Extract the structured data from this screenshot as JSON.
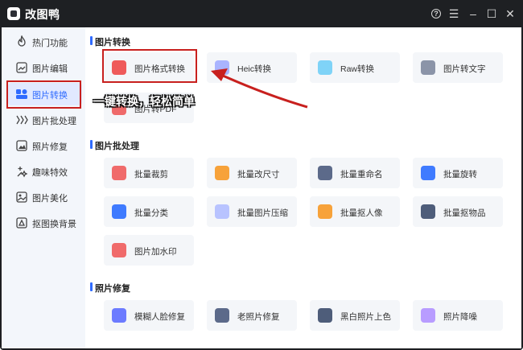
{
  "app": {
    "title": "改图鸭"
  },
  "window_controls": {
    "help": "?",
    "menu": "☰",
    "minimize": "–",
    "maximize": "☐",
    "close": "✕"
  },
  "sidebar": {
    "items": [
      {
        "label": "热门功能",
        "icon": "fire-icon"
      },
      {
        "label": "图片编辑",
        "icon": "image-edit-icon"
      },
      {
        "label": "图片转换",
        "icon": "convert-icon",
        "active": true
      },
      {
        "label": "图片批处理",
        "icon": "batch-icon"
      },
      {
        "label": "照片修复",
        "icon": "photo-repair-icon"
      },
      {
        "label": "趣味特效",
        "icon": "sparkle-icon"
      },
      {
        "label": "图片美化",
        "icon": "beautify-icon"
      },
      {
        "label": "抠图换背景",
        "icon": "cutout-icon"
      }
    ]
  },
  "sections": {
    "convert": {
      "title": "图片转换",
      "cards": [
        {
          "label": "图片格式转换",
          "color": "#ef5a5a"
        },
        {
          "label": "Heic转换",
          "color": "#a9b4ff"
        },
        {
          "label": "Raw转换",
          "color": "#7fd3f7"
        },
        {
          "label": "图片转文字",
          "color": "#8b94a8"
        },
        {
          "label": "图片转PDF",
          "color": "#ef6a6a"
        }
      ]
    },
    "batch": {
      "title": "图片批处理",
      "cards": [
        {
          "label": "批量裁剪",
          "color": "#f06b6b"
        },
        {
          "label": "批量改尺寸",
          "color": "#f7a23a"
        },
        {
          "label": "批量重命名",
          "color": "#5c6a8a"
        },
        {
          "label": "批量旋转",
          "color": "#3f7bff"
        },
        {
          "label": "批量分类",
          "color": "#3f7bff"
        },
        {
          "label": "批量图片压缩",
          "color": "#b8c3ff"
        },
        {
          "label": "批量抠人像",
          "color": "#f7a23a"
        },
        {
          "label": "批量抠物品",
          "color": "#4e5d7a"
        },
        {
          "label": "图片加水印",
          "color": "#f06b6b"
        }
      ]
    },
    "repair": {
      "title": "照片修复",
      "cards": [
        {
          "label": "模糊人脸修复",
          "color": "#6c7bff"
        },
        {
          "label": "老照片修复",
          "color": "#5c6a8a"
        },
        {
          "label": "黑白照片上色",
          "color": "#4e5d7a"
        },
        {
          "label": "照片降噪",
          "color": "#b89cff"
        }
      ]
    }
  },
  "annotation": {
    "callout": "一键转换，轻松简单",
    "accent": "#c8201e"
  }
}
